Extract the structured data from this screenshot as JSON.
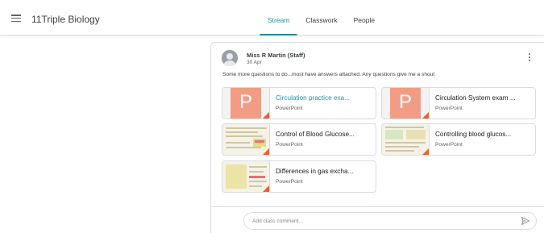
{
  "header": {
    "class_name": "11Triple Biology",
    "tabs": [
      {
        "label": "Stream",
        "active": true
      },
      {
        "label": "Classwork",
        "active": false
      },
      {
        "label": "People",
        "active": false
      }
    ]
  },
  "post": {
    "author": "Miss R Martin (Staff)",
    "date": "30 Apr",
    "message": "Some more questions to do...most have answers attached. Any questions give me a shout",
    "attachments": [
      {
        "title": "Circulation practice exa...",
        "type": "PowerPoint",
        "thumbnail": "powerpoint-icon"
      },
      {
        "title": "Circulation System exam ...",
        "type": "PowerPoint",
        "thumbnail": "powerpoint-icon"
      },
      {
        "title": "Control of Blood Glucose...",
        "type": "PowerPoint",
        "thumbnail": "slide-preview"
      },
      {
        "title": "Controlling blood glucos...",
        "type": "PowerPoint",
        "thumbnail": "slide-preview"
      },
      {
        "title": "Differences in gas excha...",
        "type": "PowerPoint",
        "thumbnail": "slide-preview"
      }
    ]
  },
  "comment": {
    "placeholder": "Add class comment..."
  },
  "colors": {
    "accent": "#1e8e9e",
    "powerpoint": "#f39c85",
    "powerpoint_corner": "#e8612c"
  }
}
